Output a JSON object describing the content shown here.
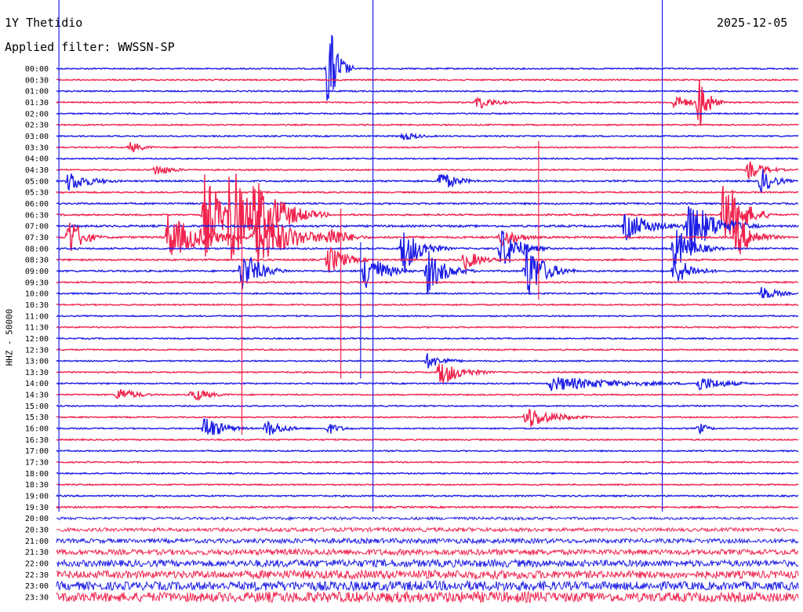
{
  "header": {
    "station": "1Y Thetidio",
    "date": "2025-12-05",
    "filter": "Applied filter: WWSSN-SP"
  },
  "chart_data": {
    "type": "helicorder",
    "channel_label": "HHZ - 50000",
    "colors": {
      "even_row": "#1e1ee6",
      "odd_row": "#f0244e",
      "event_marker": "#1e1ee6",
      "background": "#ffffff"
    },
    "time_labels": [
      "00:00",
      "00:30",
      "01:00",
      "01:30",
      "02:00",
      "02:30",
      "03:00",
      "03:30",
      "04:00",
      "04:30",
      "05:00",
      "05:30",
      "06:00",
      "06:30",
      "07:00",
      "07:30",
      "08:00",
      "08:30",
      "09:00",
      "09:30",
      "10:00",
      "10:30",
      "11:00",
      "11:30",
      "12:00",
      "12:30",
      "13:00",
      "13:30",
      "14:00",
      "14:30",
      "15:00",
      "15:30",
      "16:00",
      "16:30",
      "17:00",
      "17:30",
      "18:00",
      "18:30",
      "19:00",
      "19:30",
      "20:00",
      "20:30",
      "21:00",
      "21:30",
      "22:00",
      "22:30",
      "23:00",
      "23:30"
    ],
    "row_minutes": 30,
    "noise_level": [
      0.8,
      0.8,
      0.8,
      0.8,
      0.8,
      0.8,
      0.8,
      0.8,
      0.8,
      0.8,
      1.0,
      0.9,
      1.0,
      1.0,
      1.2,
      1.2,
      1.0,
      1.0,
      1.0,
      0.9,
      0.9,
      0.8,
      0.8,
      0.8,
      0.8,
      0.8,
      0.8,
      0.8,
      0.8,
      0.8,
      0.8,
      0.8,
      0.8,
      0.8,
      0.8,
      0.8,
      0.8,
      0.8,
      0.9,
      1.0,
      1.6,
      2.2,
      2.8,
      3.4,
      4.2,
      4.8,
      5.4,
      6.0
    ],
    "events": [
      {
        "row": 0,
        "minute": 11.0,
        "amplitude": 70,
        "duration": 1.0
      },
      {
        "row": 3,
        "minute": 17.0,
        "amplitude": 10,
        "duration": 2.0
      },
      {
        "row": 3,
        "minute": 25.0,
        "amplitude": 10,
        "duration": 2.0
      },
      {
        "row": 3,
        "minute": 26.0,
        "amplitude": 40,
        "duration": 1.0
      },
      {
        "row": 6,
        "minute": 14.0,
        "amplitude": 6,
        "duration": 2.0
      },
      {
        "row": 7,
        "minute": 3.0,
        "amplitude": 8,
        "duration": 1.5
      },
      {
        "row": 9,
        "minute": 4.0,
        "amplitude": 8,
        "duration": 2.0
      },
      {
        "row": 9,
        "minute": 28.0,
        "amplitude": 12,
        "duration": 2.0
      },
      {
        "row": 10,
        "minute": 0.5,
        "amplitude": 14,
        "duration": 2.5
      },
      {
        "row": 10,
        "minute": 15.5,
        "amplitude": 14,
        "duration": 2.0
      },
      {
        "row": 10,
        "minute": 28.5,
        "amplitude": 18,
        "duration": 1.5
      },
      {
        "row": 13,
        "minute": 6.0,
        "amplitude": 60,
        "duration": 2.0
      },
      {
        "row": 13,
        "minute": 7.0,
        "amplitude": 80,
        "duration": 2.0
      },
      {
        "row": 13,
        "minute": 8.0,
        "amplitude": 55,
        "duration": 3.0
      },
      {
        "row": 13,
        "minute": 27.0,
        "amplitude": 55,
        "duration": 2.0
      },
      {
        "row": 14,
        "minute": 23.0,
        "amplitude": 20,
        "duration": 3.0
      },
      {
        "row": 14,
        "minute": 25.5,
        "amplitude": 40,
        "duration": 3.0
      },
      {
        "row": 15,
        "minute": 0.5,
        "amplitude": 30,
        "duration": 1.5
      },
      {
        "row": 15,
        "minute": 4.5,
        "amplitude": 30,
        "duration": 4.0
      },
      {
        "row": 15,
        "minute": 8.0,
        "amplitude": 40,
        "duration": 4.0
      },
      {
        "row": 15,
        "minute": 11.0,
        "amplitude": 18,
        "duration": 2.0
      },
      {
        "row": 15,
        "minute": 18.0,
        "amplitude": 14,
        "duration": 2.0
      },
      {
        "row": 15,
        "minute": 27.5,
        "amplitude": 28,
        "duration": 2.0
      },
      {
        "row": 16,
        "minute": 14.0,
        "amplitude": 35,
        "duration": 2.0
      },
      {
        "row": 16,
        "minute": 18.0,
        "amplitude": 30,
        "duration": 2.0
      },
      {
        "row": 16,
        "minute": 25.0,
        "amplitude": 30,
        "duration": 2.0
      },
      {
        "row": 17,
        "minute": 11.0,
        "amplitude": 20,
        "duration": 2.0
      },
      {
        "row": 17,
        "minute": 16.5,
        "amplitude": 14,
        "duration": 2.0
      },
      {
        "row": 18,
        "minute": 7.5,
        "amplitude": 30,
        "duration": 2.0
      },
      {
        "row": 18,
        "minute": 12.5,
        "amplitude": 30,
        "duration": 2.0
      },
      {
        "row": 18,
        "minute": 15.0,
        "amplitude": 30,
        "duration": 2.0
      },
      {
        "row": 18,
        "minute": 19.0,
        "amplitude": 40,
        "duration": 2.0
      },
      {
        "row": 18,
        "minute": 25.0,
        "amplitude": 20,
        "duration": 2.0
      },
      {
        "row": 20,
        "minute": 28.5,
        "amplitude": 10,
        "duration": 2.0
      },
      {
        "row": 26,
        "minute": 15.0,
        "amplitude": 10,
        "duration": 2.0
      },
      {
        "row": 27,
        "minute": 15.5,
        "amplitude": 18,
        "duration": 2.5
      },
      {
        "row": 28,
        "minute": 20.0,
        "amplitude": 10,
        "duration": 8.0
      },
      {
        "row": 28,
        "minute": 26.0,
        "amplitude": 10,
        "duration": 3.0
      },
      {
        "row": 29,
        "minute": 2.5,
        "amplitude": 10,
        "duration": 2.0
      },
      {
        "row": 29,
        "minute": 5.5,
        "amplitude": 10,
        "duration": 2.0
      },
      {
        "row": 31,
        "minute": 19.0,
        "amplitude": 16,
        "duration": 3.0
      },
      {
        "row": 32,
        "minute": 6.0,
        "amplitude": 18,
        "duration": 2.0
      },
      {
        "row": 32,
        "minute": 8.5,
        "amplitude": 12,
        "duration": 2.0
      },
      {
        "row": 32,
        "minute": 11.0,
        "amplitude": 8,
        "duration": 1.5
      },
      {
        "row": 32,
        "minute": 26.0,
        "amplitude": 8,
        "duration": 1.0
      }
    ],
    "long_spikes": [
      {
        "minute": 11.5,
        "from_row": 13,
        "to_row": 27
      },
      {
        "minute": 7.5,
        "from_row": 13,
        "to_row": 32
      },
      {
        "minute": 12.3,
        "from_row": 16,
        "to_row": 27
      },
      {
        "minute": 19.5,
        "from_row": 7,
        "to_row": 20
      }
    ],
    "event_markers": [
      {
        "minute": 0.1
      },
      {
        "minute": 12.8
      },
      {
        "minute": 24.5
      }
    ]
  }
}
